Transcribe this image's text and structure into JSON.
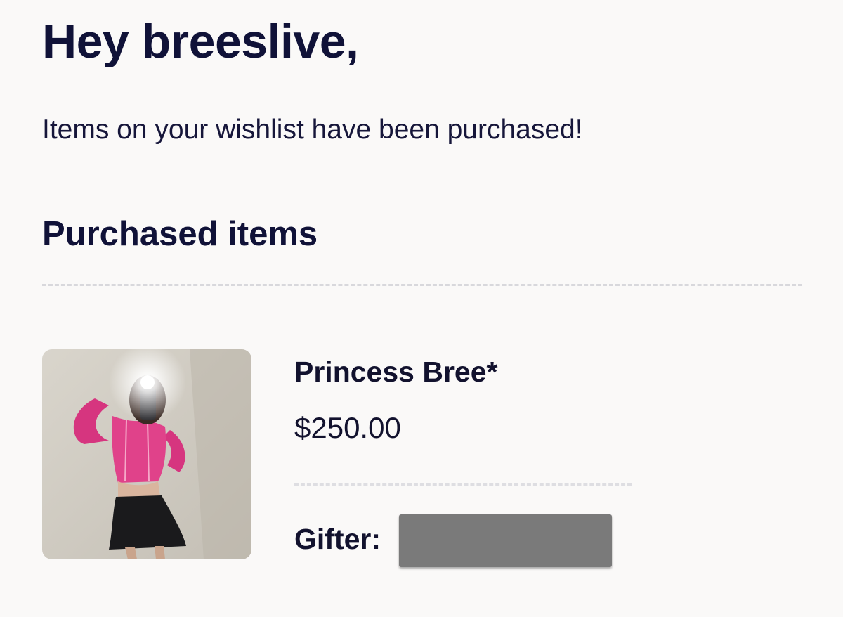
{
  "email": {
    "greeting": "Hey breeslive,",
    "intro": "Items on your wishlist have been purchased!",
    "section_title": "Purchased items"
  },
  "purchased_items": [
    {
      "name": "Princess Bree*",
      "price": "$250.00",
      "gifter_label": "Gifter:",
      "gifter_redacted": true
    }
  ],
  "colors": {
    "background": "#faf9f8",
    "heading": "#101238",
    "text": "#12122e",
    "divider": "#d8d8dc",
    "redaction": "#7a7a7a"
  }
}
